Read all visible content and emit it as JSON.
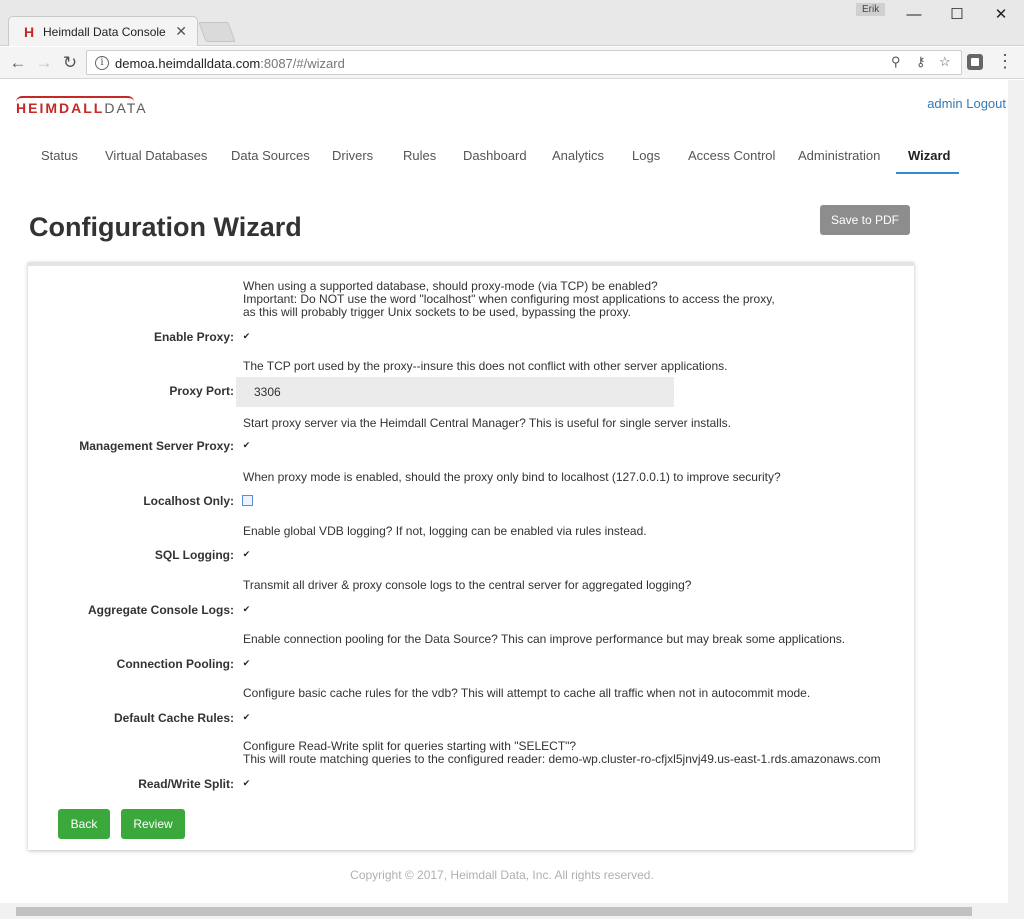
{
  "browser": {
    "tab_title": "Heimdall Data Console",
    "favicon": "H",
    "profile_name": "Erik",
    "url_host": "demoa.heimdalldata.com",
    "url_path": ":8087/#/wizard"
  },
  "header": {
    "logo_primary": "HEIMDALL",
    "logo_secondary": "DATA",
    "admin_link": "admin",
    "logout_link": "Logout"
  },
  "nav": {
    "tabs": [
      {
        "label": "Status"
      },
      {
        "label": "Virtual Databases"
      },
      {
        "label": "Data Sources"
      },
      {
        "label": "Drivers"
      },
      {
        "label": "Rules"
      },
      {
        "label": "Dashboard"
      },
      {
        "label": "Analytics"
      },
      {
        "label": "Logs"
      },
      {
        "label": "Access Control"
      },
      {
        "label": "Administration"
      },
      {
        "label": "Wizard",
        "active": true
      }
    ]
  },
  "main": {
    "title": "Configuration Wizard",
    "save_pdf_label": "Save to PDF"
  },
  "form": {
    "fields": [
      {
        "desc_lines": [
          "When using a supported database, should proxy-mode (via TCP) be enabled?",
          "Important: Do NOT use the word \"localhost\" when configuring most applications to access the proxy,",
          "as this will probably trigger Unix sockets to be used, bypassing the proxy."
        ],
        "label": "Enable Proxy:",
        "checked": true
      },
      {
        "desc_lines": [
          "The TCP port used by the proxy--insure this does not conflict with other server applications."
        ],
        "label": "Proxy Port:",
        "value": "3306"
      },
      {
        "desc_lines": [
          "Start proxy server via the Heimdall Central Manager? This is useful for single server installs."
        ],
        "label": "Management Server Proxy:",
        "checked": true
      },
      {
        "desc_lines": [
          "When proxy mode is enabled, should the proxy only bind to localhost (127.0.0.1) to improve security?"
        ],
        "label": "Localhost Only:",
        "checked": false
      },
      {
        "desc_lines": [
          "Enable global VDB logging? If not, logging can be enabled via rules instead."
        ],
        "label": "SQL Logging:",
        "checked": true
      },
      {
        "desc_lines": [
          "Transmit all driver & proxy console logs to the central server for aggregated logging?"
        ],
        "label": "Aggregate Console Logs:",
        "checked": true
      },
      {
        "desc_lines": [
          "Enable connection pooling for the Data Source? This can improve performance but may break some applications."
        ],
        "label": "Connection Pooling:",
        "checked": true
      },
      {
        "desc_lines": [
          "Configure basic cache rules for the vdb? This will attempt to cache all traffic when not in autocommit mode."
        ],
        "label": "Default Cache Rules:",
        "checked": true
      },
      {
        "desc_lines": [
          "Configure Read-Write split for queries starting with \"SELECT\"?",
          "This will route matching queries to the configured reader: demo-wp.cluster-ro-cfjxl5jnvj49.us-east-1.rds.amazonaws.com"
        ],
        "label": "Read/Write Split:",
        "checked": true
      }
    ],
    "back_label": "Back",
    "review_label": "Review"
  },
  "footer": {
    "copyright": "Copyright © 2017, Heimdall Data, Inc. All rights reserved."
  },
  "colors": {
    "brand_red": "#c62828",
    "link_blue": "#337ab7",
    "active_tab_underline": "#2f8fd6",
    "button_green": "#3aa83a",
    "button_gray": "#8d8d8d"
  }
}
